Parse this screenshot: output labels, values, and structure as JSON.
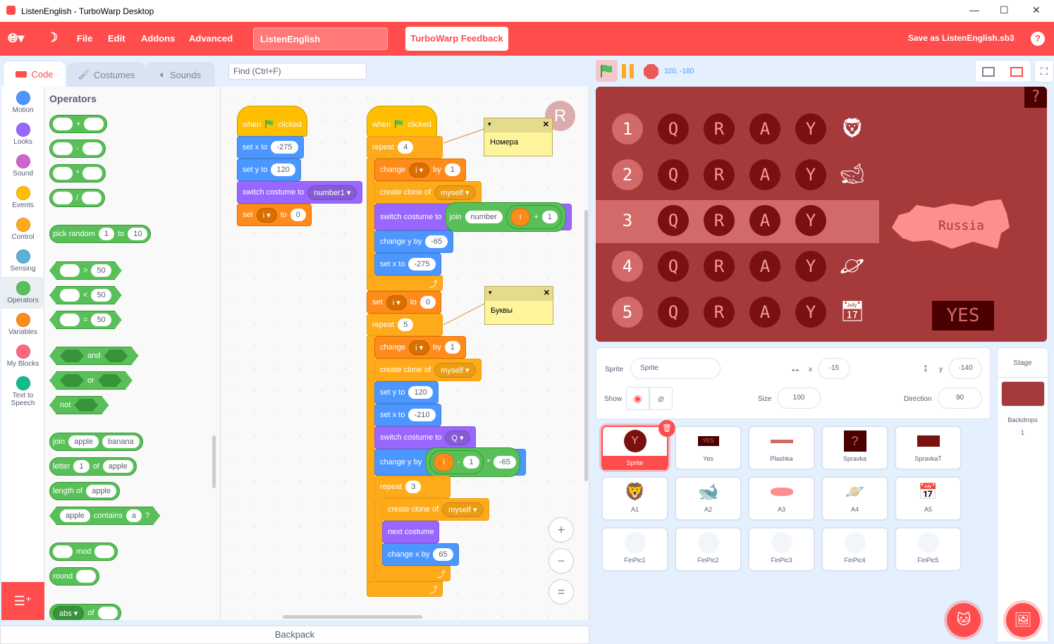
{
  "window": {
    "title": "ListenEnglish - TurboWarp Desktop",
    "minimize": "—",
    "maximize": "☐",
    "close": "✕"
  },
  "menubar": {
    "items": [
      "File",
      "Edit",
      "Addons",
      "Advanced"
    ],
    "project_title": "ListenEnglish",
    "feedback": "TurboWarp Feedback",
    "save": "Save as ListenEnglish.sb3",
    "help": "?"
  },
  "tabs": [
    {
      "label": "Code",
      "icon": "code-icon"
    },
    {
      "label": "Costumes",
      "icon": "brush-icon"
    },
    {
      "label": "Sounds",
      "icon": "speaker-icon"
    }
  ],
  "find": {
    "placeholder": "Find (Ctrl+F)"
  },
  "categories": [
    {
      "label": "Motion",
      "color": "#4c97ff"
    },
    {
      "label": "Looks",
      "color": "#9966ff"
    },
    {
      "label": "Sound",
      "color": "#cf63cf"
    },
    {
      "label": "Events",
      "color": "#ffbf00"
    },
    {
      "label": "Control",
      "color": "#ffab19"
    },
    {
      "label": "Sensing",
      "color": "#5cb1d6"
    },
    {
      "label": "Operators",
      "color": "#59c059",
      "selected": true
    },
    {
      "label": "Variables",
      "color": "#ff8c1a"
    },
    {
      "label": "My Blocks",
      "color": "#ff6680"
    },
    {
      "label": "Text to Speech",
      "color": "#0fbd8c"
    }
  ],
  "palette": {
    "heading": "Operators",
    "blocks": [
      {
        "shape": "rep",
        "parts": [
          {
            "h": 1
          },
          "+",
          {
            "h": 1
          }
        ]
      },
      {
        "shape": "rep",
        "parts": [
          {
            "h": 1
          },
          "-",
          {
            "h": 1
          }
        ]
      },
      {
        "shape": "rep",
        "parts": [
          {
            "h": 1
          },
          "*",
          {
            "h": 1
          }
        ]
      },
      {
        "shape": "rep",
        "parts": [
          {
            "h": 1
          },
          "/",
          {
            "h": 1
          }
        ]
      },
      {
        "shape": "rep",
        "parts": [
          "pick random",
          {
            "n": "1"
          },
          "to",
          {
            "n": "10"
          }
        ]
      },
      {
        "shape": "bool",
        "parts": [
          {
            "h": 1
          },
          ">",
          {
            "n": "50"
          }
        ]
      },
      {
        "shape": "bool",
        "parts": [
          {
            "h": 1
          },
          "<",
          {
            "n": "50"
          }
        ]
      },
      {
        "shape": "bool",
        "parts": [
          {
            "h": 1
          },
          "=",
          {
            "n": "50"
          }
        ]
      },
      {
        "shape": "bool",
        "parts": [
          {
            "b": 1
          },
          "and",
          {
            "b": 1
          }
        ]
      },
      {
        "shape": "bool",
        "parts": [
          {
            "b": 1
          },
          "or",
          {
            "b": 1
          }
        ]
      },
      {
        "shape": "bool",
        "parts": [
          "not",
          {
            "b": 1
          }
        ]
      },
      {
        "shape": "rep",
        "parts": [
          "join",
          {
            "n": "apple"
          },
          {
            "n": "banana"
          }
        ]
      },
      {
        "shape": "rep",
        "parts": [
          "letter",
          {
            "n": "1"
          },
          "of",
          {
            "n": "apple"
          }
        ]
      },
      {
        "shape": "rep",
        "parts": [
          "length of",
          {
            "n": "apple"
          }
        ]
      },
      {
        "shape": "bool",
        "parts": [
          {
            "n": "apple"
          },
          "contains",
          {
            "n": "a"
          },
          "?"
        ]
      },
      {
        "shape": "rep",
        "parts": [
          {
            "h": 1
          },
          "mod",
          {
            "h": 1
          }
        ]
      },
      {
        "shape": "rep",
        "parts": [
          "round",
          {
            "h": 1
          }
        ]
      },
      {
        "shape": "rep",
        "parts": [
          {
            "d": "abs"
          },
          "of",
          {
            "h": 1
          }
        ]
      }
    ]
  },
  "block_colors": {
    "motion": "#4c97ff",
    "looks": "#9966ff",
    "events": "#ffbf00",
    "control": "#ffab19",
    "variables": "#ff8c1a",
    "operators": "#59c059"
  },
  "scripts": [
    {
      "blocks": [
        {
          "cat": "events",
          "hat": true,
          "parts": [
            "when",
            {
              "flag": 1
            },
            "clicked"
          ]
        },
        {
          "cat": "motion",
          "parts": [
            "set x to",
            {
              "n": "-275"
            }
          ]
        },
        {
          "cat": "motion",
          "parts": [
            "set y to",
            {
              "n": "120"
            }
          ]
        },
        {
          "cat": "looks",
          "parts": [
            "switch costume to",
            {
              "d": "number1"
            }
          ]
        },
        {
          "cat": "variables",
          "parts": [
            "set",
            {
              "d": "i"
            },
            "to",
            {
              "n": "0"
            }
          ]
        }
      ]
    },
    {
      "blocks": [
        {
          "cat": "events",
          "hat": true,
          "parts": [
            "when",
            {
              "flag": 1
            },
            "clicked"
          ]
        },
        {
          "cat": "control",
          "c": true,
          "parts": [
            "repeat",
            {
              "n": "4"
            }
          ]
        },
        {
          "cat": "variables",
          "parts": [
            "change",
            {
              "d": "i"
            },
            "by",
            {
              "n": "1"
            }
          ]
        },
        {
          "cat": "control",
          "parts": [
            "create clone of",
            {
              "d": "myself"
            }
          ]
        },
        {
          "cat": "looks",
          "tall": true,
          "parts": [
            "switch costume to",
            {
              "op": [
                "join",
                {
                  "n": "number"
                },
                {
                  "op": [
                    {
                      "var": "i"
                    },
                    "+",
                    {
                      "n": "1"
                    }
                  ]
                }
              ]
            }
          ]
        },
        {
          "cat": "motion",
          "parts": [
            "change y by",
            {
              "n": "-65"
            }
          ]
        },
        {
          "cat": "motion",
          "parts": [
            "set x to",
            {
              "n": "-275"
            }
          ]
        },
        {
          "end": true
        },
        {
          "cat": "variables",
          "parts": [
            "set",
            {
              "d": "i"
            },
            "to",
            {
              "n": "0"
            }
          ]
        },
        {
          "cat": "control",
          "c": true,
          "parts": [
            "repeat",
            {
              "n": "5"
            }
          ]
        },
        {
          "cat": "variables",
          "parts": [
            "change",
            {
              "d": "i"
            },
            "by",
            {
              "n": "1"
            }
          ]
        },
        {
          "cat": "control",
          "parts": [
            "create clone of",
            {
              "d": "myself"
            }
          ]
        },
        {
          "cat": "motion",
          "parts": [
            "set y to",
            {
              "n": "120"
            }
          ]
        },
        {
          "cat": "motion",
          "parts": [
            "set x to",
            {
              "n": "-210"
            }
          ]
        },
        {
          "cat": "looks",
          "parts": [
            "switch costume to",
            {
              "d": "Q"
            }
          ]
        },
        {
          "cat": "motion",
          "tall": true,
          "parts": [
            "change y by",
            {
              "op": [
                {
                  "op": [
                    {
                      "var": "i"
                    },
                    "-",
                    {
                      "n": "1"
                    }
                  ]
                },
                "*",
                {
                  "n": "-65"
                }
              ]
            }
          ]
        },
        {
          "cat": "control",
          "c": true,
          "parts": [
            "repeat",
            {
              "n": "3"
            }
          ]
        },
        {
          "cat": "control",
          "parts": [
            "create clone of",
            {
              "d": "myself"
            }
          ]
        },
        {
          "cat": "looks",
          "parts": [
            "next costume"
          ]
        },
        {
          "cat": "motion",
          "parts": [
            "change x by",
            {
              "n": "65"
            }
          ]
        },
        {
          "end": true
        },
        {
          "end": true
        }
      ]
    }
  ],
  "comments": [
    "Номера",
    "Буквы"
  ],
  "workspace": {
    "sprite_badge": "R",
    "zoom_in": "+",
    "zoom_out": "−",
    "zoom_reset": "="
  },
  "backpack": "Backpack",
  "stage_header": {
    "coords": "320, -180"
  },
  "stage": {
    "help": "?",
    "rows": [
      {
        "num": "1",
        "letters": [
          "Q",
          "R",
          "A",
          "Y"
        ],
        "icon": "lion-icon"
      },
      {
        "num": "2",
        "letters": [
          "Q",
          "R",
          "A",
          "Y"
        ],
        "icon": "whale-icon"
      },
      {
        "num": "3",
        "letters": [
          "Q",
          "R",
          "A",
          "Y"
        ],
        "icon": "",
        "highlight": true
      },
      {
        "num": "4",
        "letters": [
          "Q",
          "R",
          "A",
          "Y"
        ],
        "icon": "planet-icon"
      },
      {
        "num": "5",
        "letters": [
          "Q",
          "R",
          "A",
          "Y"
        ],
        "icon": "calendar-icon"
      }
    ],
    "map_label": "Russia",
    "yes": "YES",
    "colors": {
      "bg": "#a63a3a",
      "circle": "#7a1010",
      "highlight": "#d36a6a"
    }
  },
  "sprite_info": {
    "sprite_label": "Sprite",
    "name": "Sprite",
    "x_label": "x",
    "x": "-15",
    "y_label": "y",
    "y": "-140",
    "show_label": "Show",
    "size_label": "Size",
    "size": "100",
    "direction_label": "Direction",
    "direction": "90"
  },
  "sprites": [
    {
      "name": "Sprite",
      "selected": true,
      "thumb": "Y"
    },
    {
      "name": "Yes",
      "thumb": "YES"
    },
    {
      "name": "Plashka",
      "thumb": "bar"
    },
    {
      "name": "Spravka",
      "thumb": "?"
    },
    {
      "name": "SpravkaT",
      "thumb": "text"
    },
    {
      "name": "A1",
      "thumb": "lion"
    },
    {
      "name": "A2",
      "thumb": "whale"
    },
    {
      "name": "A3",
      "thumb": "map"
    },
    {
      "name": "A4",
      "thumb": "planet"
    },
    {
      "name": "A5",
      "thumb": "calendar"
    },
    {
      "name": "FinPic1",
      "thumb": "ghost"
    },
    {
      "name": "FinPic2",
      "thumb": "ghost"
    },
    {
      "name": "FinPic3",
      "thumb": "ghost"
    },
    {
      "name": "FinPic4",
      "thumb": "ghost"
    },
    {
      "name": "FinPic5",
      "thumb": "ghost"
    }
  ],
  "stage_pane": {
    "title": "Stage",
    "backdrops_label": "Backdrops",
    "backdrops": "1"
  }
}
